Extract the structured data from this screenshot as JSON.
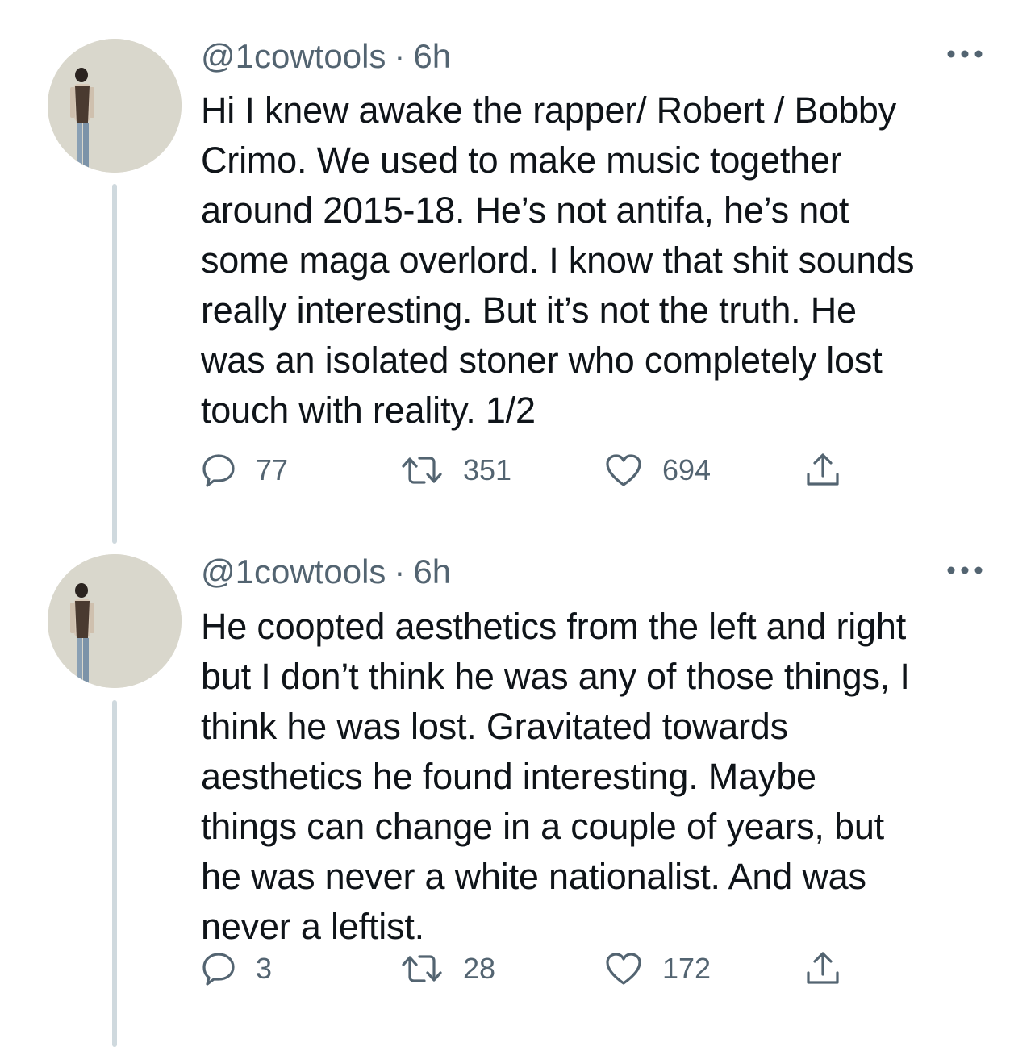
{
  "tweets": [
    {
      "handle": "@1cowtools",
      "separator": "·",
      "time": "6h",
      "text": "Hi I knew awake the rapper/ Robert / Bobby\nCrimo. We used to make music together\naround 2015-18. He’s not antifa, he’s not\nsome maga overlord. I know that shit sounds\nreally interesting. But it’s not the truth. He\nwas an isolated stoner who completely lost\ntouch with reality. 1/2",
      "replies": "77",
      "retweets": "351",
      "likes": "694"
    },
    {
      "handle": "@1cowtools",
      "separator": "·",
      "time": "6h",
      "text": "He coopted aesthetics from the left and right\nbut I don’t think he was any of those things, I\nthink he was lost. Gravitated towards\naesthetics he found interesting. Maybe\nthings can change in a couple of years, but\nhe was never a white nationalist. And was\nnever a leftist.",
      "replies": "3",
      "retweets": "28",
      "likes": "172"
    }
  ],
  "icons": {
    "reply": "speech-bubble",
    "retweet": "two-arrows-loop",
    "like": "heart-outline",
    "share": "upload-arrow",
    "more": "three-dots-horizontal"
  },
  "colors": {
    "text": "#0f1419",
    "secondary": "#536471",
    "thread_line": "#cfd9de",
    "avatar_bg": "#d9d7cc"
  }
}
